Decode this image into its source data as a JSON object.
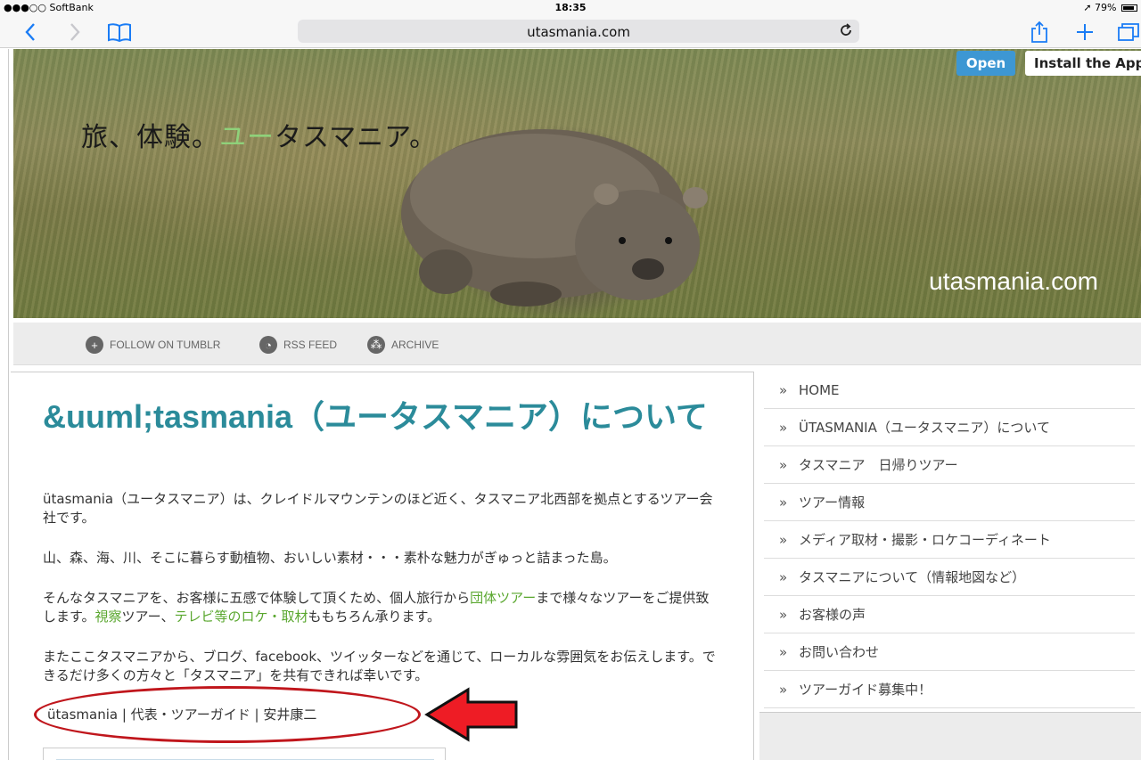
{
  "status_bar": {
    "carrier": "●●●○○ SoftBank",
    "time": "18:35",
    "battery": "79%"
  },
  "browser": {
    "url": "utasmania.com"
  },
  "hero": {
    "title_before": "旅、体験。",
    "title_accent": "ユー",
    "title_after": "タスマニア。",
    "site_name": "utasmania.com",
    "open_label": "Open",
    "install_label": "Install the App"
  },
  "followbar": {
    "items": [
      {
        "label": "FOLLOW ON TUMBLR",
        "icon": "plus-circle-icon"
      },
      {
        "label": "RSS FEED",
        "icon": "rss-icon"
      },
      {
        "label": "ARCHIVE",
        "icon": "archive-icon"
      }
    ]
  },
  "post": {
    "title": "&uuml;tasmania（ユータスマニア）について",
    "p1": "ütasmania（ユータスマニア）は、クレイドルマウンテンのほど近く、タスマニア北西部を拠点とするツアー会社です。",
    "p2": "山、森、海、川、そこに暮らす動植物、おいしい素材・・・素朴な魅力がぎゅっと詰まった島。",
    "p3": {
      "t1": "そんなタスマニアを、お客様に五感で体験して頂くため、個人旅行から",
      "link1": "団体ツアー",
      "t2": "まで様々なツアーをご提供致します。",
      "link2": "視察",
      "t3": "ツアー、",
      "link3": "テレビ等のロケ・取材",
      "t4": "ももちろん承ります。"
    },
    "p4": "またここタスマニアから、ブログ、facebook、ツイッターなどを通じて、ローカルな雰囲気をお伝えします。できるだけ多くの方々と「タスマニア」を共有できれば幸いです。",
    "signature": "ütasmania | 代表・ツアーガイド | 安井康二"
  },
  "sidebar": {
    "items": [
      {
        "label": "HOME"
      },
      {
        "label": "ÜTASMANIA（ユータスマニア）について"
      },
      {
        "label": "タスマニア　日帰りツアー"
      },
      {
        "label": "ツアー情報"
      },
      {
        "label": "メディア取材・撮影・ロケコーディネート"
      },
      {
        "label": "タスマニアについて（情報地図など）"
      },
      {
        "label": "お客様の声"
      },
      {
        "label": "お問い合わせ"
      },
      {
        "label": "ツアーガイド募集中！"
      }
    ],
    "chevron": "»"
  },
  "colors": {
    "title_teal": "#2b8b9a",
    "link_green": "#5aa72f",
    "annotation_red": "#c0161c",
    "open_blue": "#3d97d3"
  }
}
